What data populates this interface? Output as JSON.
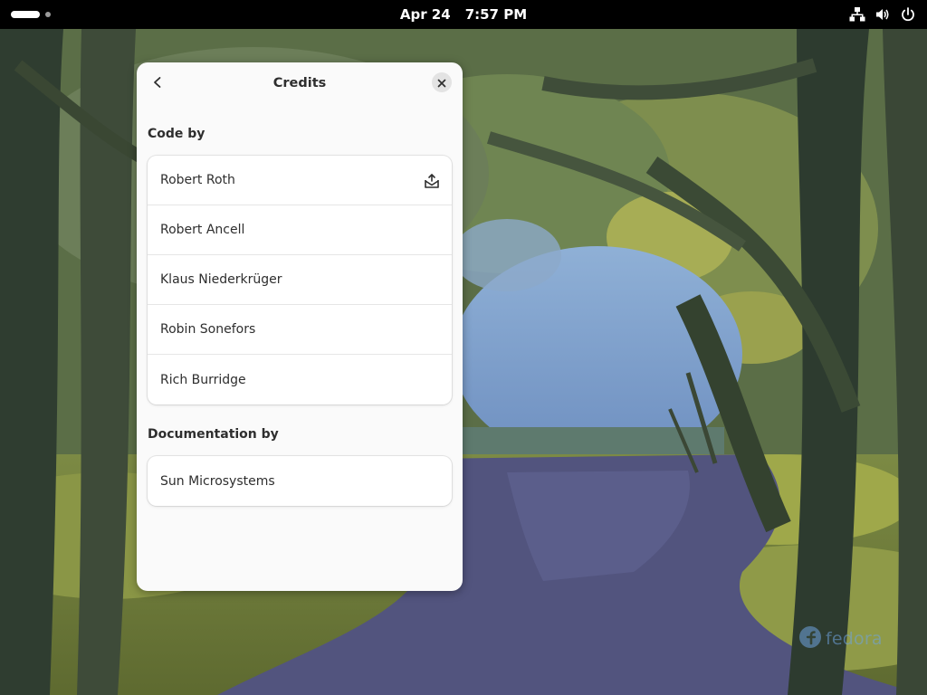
{
  "topbar": {
    "date": "Apr 24",
    "time": "7:57 PM",
    "icons": [
      "network-wired-icon",
      "volume-icon",
      "power-icon"
    ]
  },
  "window": {
    "title": "Credits",
    "sections": [
      {
        "heading": "Code by",
        "people": [
          "Robert Roth",
          "Robert Ancell",
          "Klaus Niederkrüger",
          "Robin Sonefors",
          "Rich Burridge"
        ]
      },
      {
        "heading": "Documentation by",
        "people": [
          "Sun Microsystems"
        ]
      }
    ]
  },
  "watermark": {
    "text": "fedora"
  },
  "colors": {
    "window_bg": "#fafafa",
    "card_bg": "#ffffff",
    "topbar_bg": "#000000",
    "text": "#2e2e2e",
    "fedora_blue": "#6fa4e0"
  }
}
